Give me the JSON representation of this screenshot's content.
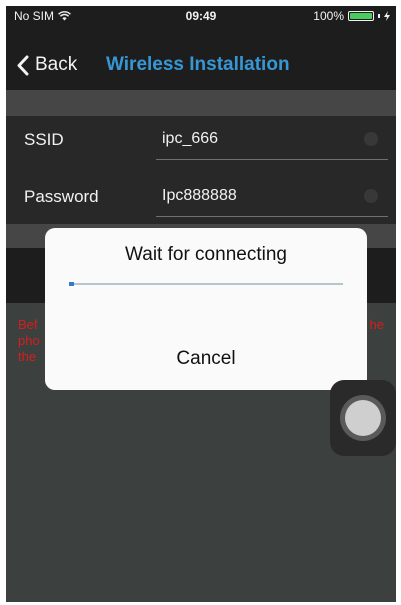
{
  "status_bar": {
    "carrier": "No SIM",
    "time": "09:49",
    "battery_percent": "100%",
    "battery_level": 1.0,
    "icons": [
      "wifi-icon",
      "battery-icon",
      "charging-icon"
    ]
  },
  "nav": {
    "back_label": "Back",
    "title": "Wireless Installation"
  },
  "form": {
    "ssid_label": "SSID",
    "ssid_value": "ipc_666",
    "password_label": "Password",
    "password_value": "Ipc888888"
  },
  "hint": {
    "line1_left": "Bef",
    "line1_right": "he",
    "line2_left": "pho",
    "line3_left": "the"
  },
  "dialog": {
    "title": "Wait for connecting",
    "progress": 0.02,
    "cancel_label": "Cancel"
  },
  "colors": {
    "accent": "#3aa0e0",
    "hint_text": "#e02020",
    "progress": "#2f7ec7",
    "battery": "#4cd964"
  }
}
